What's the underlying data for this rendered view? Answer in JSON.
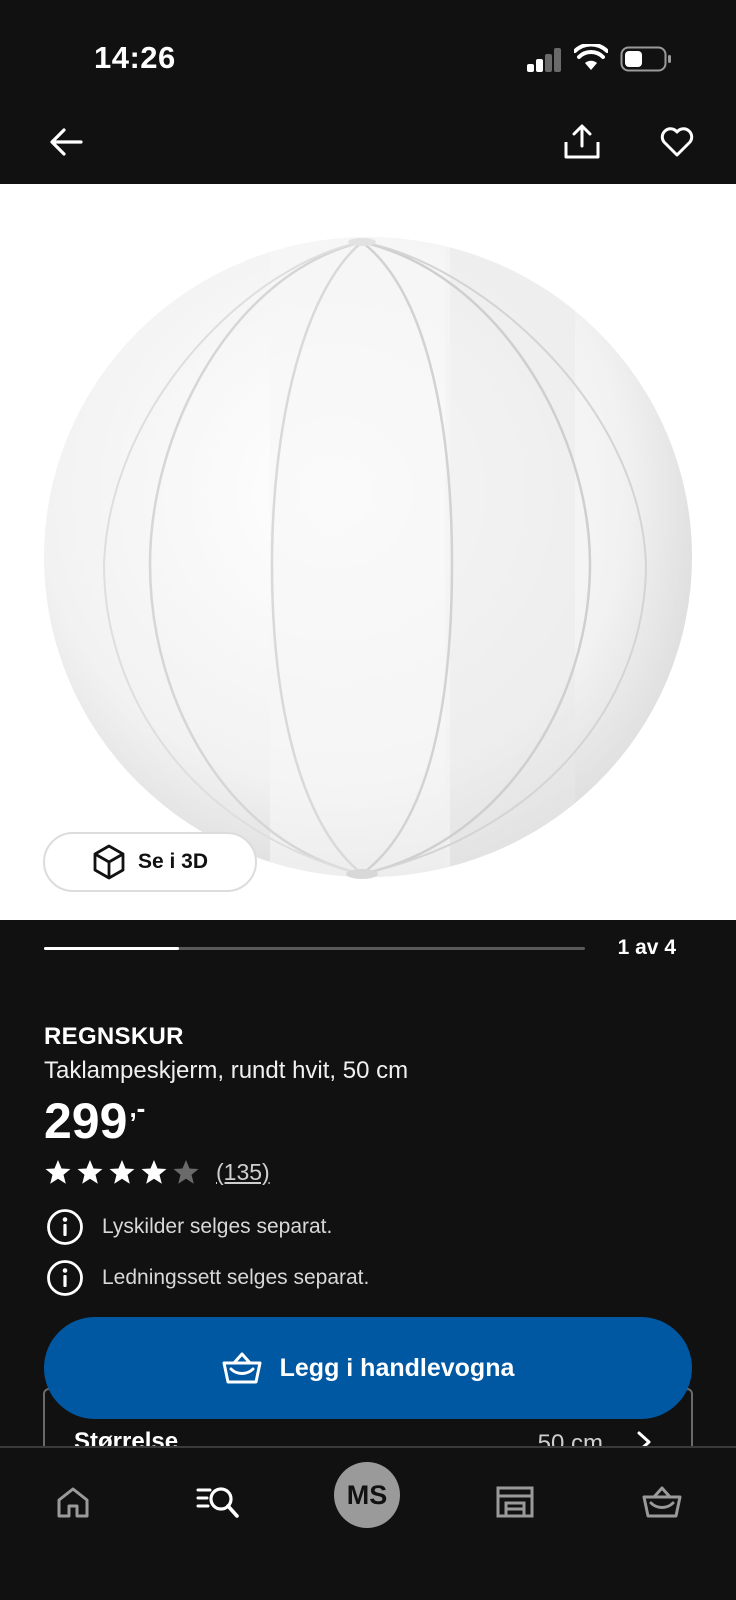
{
  "status_bar": {
    "time": "14:26"
  },
  "gallery": {
    "view_3d_label": "Se i 3D",
    "page_indicator": "1 av 4",
    "progress_fraction": 0.25
  },
  "product": {
    "name": "REGNSKUR",
    "description": "Taklampeskjerm, rundt hvit, 50 cm",
    "price": "299",
    "price_suffix": ",-",
    "rating_stars": 4,
    "rating_max": 5,
    "rating_count": "(135)",
    "notices": [
      "Lyskilder selges separat.",
      "Ledningssett selges separat."
    ]
  },
  "cta": {
    "label": "Legg i handlevogna"
  },
  "size": {
    "label": "Størrelse",
    "value": "50 cm"
  },
  "nav": {
    "avatar_initials": "MS"
  },
  "colors": {
    "accent": "#0058a3",
    "background": "#111111"
  },
  "icons": [
    "back-arrow-icon",
    "share-icon",
    "heart-icon",
    "cube-3d-icon",
    "star-icon",
    "info-icon",
    "basket-icon",
    "home-icon",
    "search-menu-icon",
    "store-icon"
  ]
}
